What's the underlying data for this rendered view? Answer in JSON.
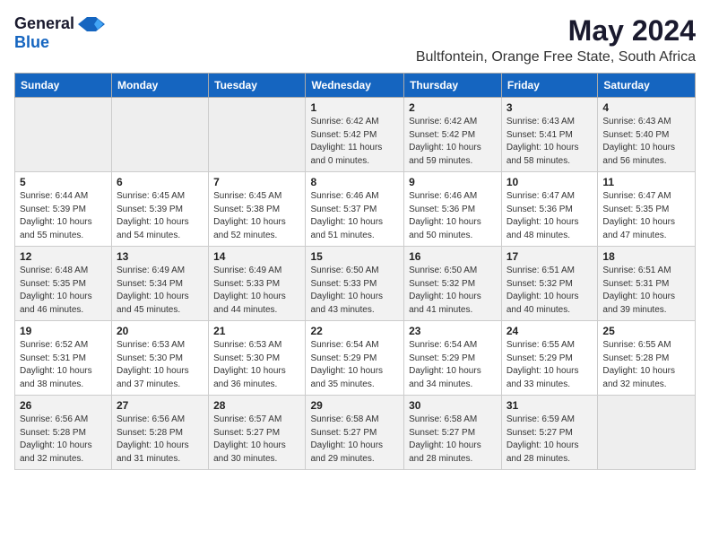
{
  "header": {
    "logo_general": "General",
    "logo_blue": "Blue",
    "month": "May 2024",
    "location": "Bultfontein, Orange Free State, South Africa"
  },
  "weekdays": [
    "Sunday",
    "Monday",
    "Tuesday",
    "Wednesday",
    "Thursday",
    "Friday",
    "Saturday"
  ],
  "weeks": [
    [
      {
        "day": "",
        "info": ""
      },
      {
        "day": "",
        "info": ""
      },
      {
        "day": "",
        "info": ""
      },
      {
        "day": "1",
        "info": "Sunrise: 6:42 AM\nSunset: 5:42 PM\nDaylight: 11 hours\nand 0 minutes."
      },
      {
        "day": "2",
        "info": "Sunrise: 6:42 AM\nSunset: 5:42 PM\nDaylight: 10 hours\nand 59 minutes."
      },
      {
        "day": "3",
        "info": "Sunrise: 6:43 AM\nSunset: 5:41 PM\nDaylight: 10 hours\nand 58 minutes."
      },
      {
        "day": "4",
        "info": "Sunrise: 6:43 AM\nSunset: 5:40 PM\nDaylight: 10 hours\nand 56 minutes."
      }
    ],
    [
      {
        "day": "5",
        "info": "Sunrise: 6:44 AM\nSunset: 5:39 PM\nDaylight: 10 hours\nand 55 minutes."
      },
      {
        "day": "6",
        "info": "Sunrise: 6:45 AM\nSunset: 5:39 PM\nDaylight: 10 hours\nand 54 minutes."
      },
      {
        "day": "7",
        "info": "Sunrise: 6:45 AM\nSunset: 5:38 PM\nDaylight: 10 hours\nand 52 minutes."
      },
      {
        "day": "8",
        "info": "Sunrise: 6:46 AM\nSunset: 5:37 PM\nDaylight: 10 hours\nand 51 minutes."
      },
      {
        "day": "9",
        "info": "Sunrise: 6:46 AM\nSunset: 5:36 PM\nDaylight: 10 hours\nand 50 minutes."
      },
      {
        "day": "10",
        "info": "Sunrise: 6:47 AM\nSunset: 5:36 PM\nDaylight: 10 hours\nand 48 minutes."
      },
      {
        "day": "11",
        "info": "Sunrise: 6:47 AM\nSunset: 5:35 PM\nDaylight: 10 hours\nand 47 minutes."
      }
    ],
    [
      {
        "day": "12",
        "info": "Sunrise: 6:48 AM\nSunset: 5:35 PM\nDaylight: 10 hours\nand 46 minutes."
      },
      {
        "day": "13",
        "info": "Sunrise: 6:49 AM\nSunset: 5:34 PM\nDaylight: 10 hours\nand 45 minutes."
      },
      {
        "day": "14",
        "info": "Sunrise: 6:49 AM\nSunset: 5:33 PM\nDaylight: 10 hours\nand 44 minutes."
      },
      {
        "day": "15",
        "info": "Sunrise: 6:50 AM\nSunset: 5:33 PM\nDaylight: 10 hours\nand 43 minutes."
      },
      {
        "day": "16",
        "info": "Sunrise: 6:50 AM\nSunset: 5:32 PM\nDaylight: 10 hours\nand 41 minutes."
      },
      {
        "day": "17",
        "info": "Sunrise: 6:51 AM\nSunset: 5:32 PM\nDaylight: 10 hours\nand 40 minutes."
      },
      {
        "day": "18",
        "info": "Sunrise: 6:51 AM\nSunset: 5:31 PM\nDaylight: 10 hours\nand 39 minutes."
      }
    ],
    [
      {
        "day": "19",
        "info": "Sunrise: 6:52 AM\nSunset: 5:31 PM\nDaylight: 10 hours\nand 38 minutes."
      },
      {
        "day": "20",
        "info": "Sunrise: 6:53 AM\nSunset: 5:30 PM\nDaylight: 10 hours\nand 37 minutes."
      },
      {
        "day": "21",
        "info": "Sunrise: 6:53 AM\nSunset: 5:30 PM\nDaylight: 10 hours\nand 36 minutes."
      },
      {
        "day": "22",
        "info": "Sunrise: 6:54 AM\nSunset: 5:29 PM\nDaylight: 10 hours\nand 35 minutes."
      },
      {
        "day": "23",
        "info": "Sunrise: 6:54 AM\nSunset: 5:29 PM\nDaylight: 10 hours\nand 34 minutes."
      },
      {
        "day": "24",
        "info": "Sunrise: 6:55 AM\nSunset: 5:29 PM\nDaylight: 10 hours\nand 33 minutes."
      },
      {
        "day": "25",
        "info": "Sunrise: 6:55 AM\nSunset: 5:28 PM\nDaylight: 10 hours\nand 32 minutes."
      }
    ],
    [
      {
        "day": "26",
        "info": "Sunrise: 6:56 AM\nSunset: 5:28 PM\nDaylight: 10 hours\nand 32 minutes."
      },
      {
        "day": "27",
        "info": "Sunrise: 6:56 AM\nSunset: 5:28 PM\nDaylight: 10 hours\nand 31 minutes."
      },
      {
        "day": "28",
        "info": "Sunrise: 6:57 AM\nSunset: 5:27 PM\nDaylight: 10 hours\nand 30 minutes."
      },
      {
        "day": "29",
        "info": "Sunrise: 6:58 AM\nSunset: 5:27 PM\nDaylight: 10 hours\nand 29 minutes."
      },
      {
        "day": "30",
        "info": "Sunrise: 6:58 AM\nSunset: 5:27 PM\nDaylight: 10 hours\nand 28 minutes."
      },
      {
        "day": "31",
        "info": "Sunrise: 6:59 AM\nSunset: 5:27 PM\nDaylight: 10 hours\nand 28 minutes."
      },
      {
        "day": "",
        "info": ""
      }
    ]
  ]
}
